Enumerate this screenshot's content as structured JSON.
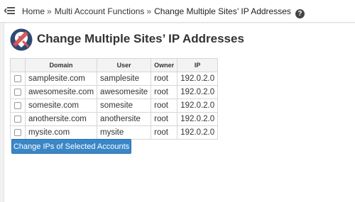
{
  "breadcrumb": {
    "home": "Home",
    "separator": "»",
    "section": "Multi Account Functions",
    "current": "Change Multiple Sites’ IP Addresses",
    "help_icon": "question-circle-icon",
    "help_glyph": "?"
  },
  "page": {
    "title": "Change Multiple Sites’ IP Addresses",
    "icon": "ip-address-icon",
    "icon_text": "IP"
  },
  "table": {
    "headers": {
      "domain": "Domain",
      "user": "User",
      "owner": "Owner",
      "ip": "IP"
    },
    "rows": [
      {
        "domain": "samplesite.com",
        "user": "samplesite",
        "owner": "root",
        "ip": "192.0.2.0"
      },
      {
        "domain": "awesomesite.com",
        "user": "awesomesite",
        "owner": "root",
        "ip": "192.0.2.0"
      },
      {
        "domain": "somesite.com",
        "user": "somesite",
        "owner": "root",
        "ip": "192.0.2.0"
      },
      {
        "domain": "anothersite.com",
        "user": "anothersite",
        "owner": "root",
        "ip": "192.0.2.0"
      },
      {
        "domain": "mysite.com",
        "user": "mysite",
        "owner": "root",
        "ip": "192.0.2.0"
      }
    ]
  },
  "actions": {
    "change_button": "Change IPs of Selected Accounts"
  },
  "colors": {
    "button": "#3a87c8",
    "icon_red": "#d9534f",
    "icon_navy": "#2f4a73"
  }
}
